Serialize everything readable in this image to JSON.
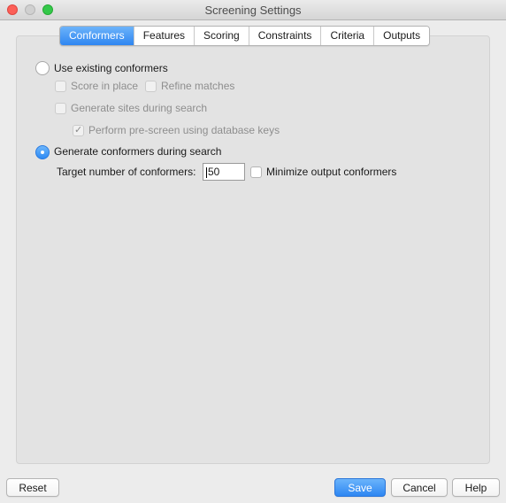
{
  "window": {
    "title": "Screening Settings"
  },
  "tabs": [
    {
      "label": "Conformers",
      "active": true
    },
    {
      "label": "Features"
    },
    {
      "label": "Scoring"
    },
    {
      "label": "Constraints"
    },
    {
      "label": "Criteria"
    },
    {
      "label": "Outputs"
    }
  ],
  "conformers": {
    "use_existing": {
      "label": "Use existing conformers",
      "selected": false
    },
    "score_in_place": {
      "label": "Score in place",
      "checked": false,
      "enabled": false
    },
    "refine_matches": {
      "label": "Refine matches",
      "checked": false,
      "enabled": false
    },
    "generate_sites": {
      "label": "Generate sites during search",
      "checked": false,
      "enabled": false
    },
    "pre_screen": {
      "label": "Perform pre-screen using database keys",
      "checked": true,
      "enabled": false
    },
    "generate_during_search": {
      "label": "Generate conformers during search",
      "selected": true
    },
    "target_number": {
      "label": "Target number of conformers:",
      "value": "50"
    },
    "minimize_output": {
      "label": "Minimize output conformers",
      "checked": false
    }
  },
  "buttons": {
    "reset": "Reset",
    "save": "Save",
    "cancel": "Cancel",
    "help": "Help"
  },
  "colors": {
    "accent": "#2f86f1",
    "close": "#fc5f57",
    "maximize": "#34c84a"
  }
}
